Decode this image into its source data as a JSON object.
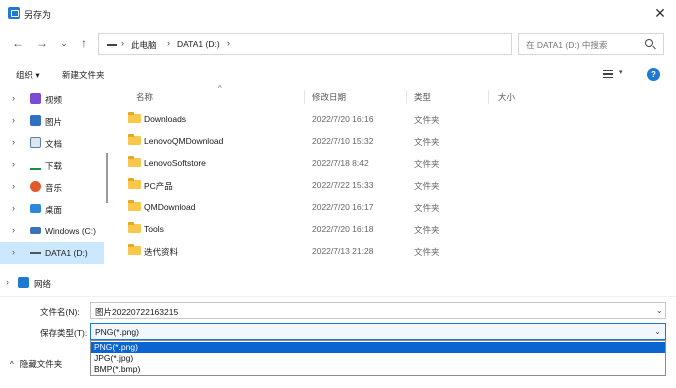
{
  "window": {
    "title": "另存为",
    "close_glyph": "✕"
  },
  "nav": {
    "back_glyph": "←",
    "forward_glyph": "→",
    "recent_glyph": "⌄",
    "up_glyph": "↑",
    "breadcrumb": [
      "此电脑",
      "DATA1 (D:)"
    ],
    "crumb_sep": "›",
    "dropdown_glyph": "⌄",
    "refresh_glyph": "↻"
  },
  "search": {
    "placeholder": "在 DATA1 (D:) 中搜索"
  },
  "toolbar": {
    "organize_label": "组织 ▾",
    "new_folder_label": "新建文件夹",
    "view_caret": "▾",
    "help_glyph": "?"
  },
  "sidebar": {
    "chevron": "›",
    "items": [
      {
        "label": "视频",
        "color": "#7b4bd6"
      },
      {
        "label": "图片",
        "color": "#2f6fc4"
      },
      {
        "label": "文档",
        "color": "#5c7fa6"
      },
      {
        "label": "下载",
        "color": "#1e8b4f"
      },
      {
        "label": "音乐",
        "color": "#e25a2b"
      },
      {
        "label": "桌面",
        "color": "#2a8ad9"
      },
      {
        "label": "Windows (C:)",
        "color": "#3c72b8"
      },
      {
        "label": "DATA1 (D:)",
        "color": "#555555"
      },
      {
        "label": "网络",
        "color": "#1f78d1"
      }
    ]
  },
  "columns": {
    "name": "名称",
    "date": "修改日期",
    "type": "类型",
    "size": "大小",
    "sort_glyph": "^"
  },
  "files": [
    {
      "name": "Downloads",
      "date": "2022/7/20 16:16",
      "type": "文件夹"
    },
    {
      "name": "LenovoQMDownload",
      "date": "2022/7/10 15:32",
      "type": "文件夹"
    },
    {
      "name": "LenovoSoftstore",
      "date": "2022/7/18 8:42",
      "type": "文件夹"
    },
    {
      "name": "PC产品",
      "date": "2022/7/22 15:33",
      "type": "文件夹"
    },
    {
      "name": "QMDownload",
      "date": "2022/7/20 16:17",
      "type": "文件夹"
    },
    {
      "name": "Tools",
      "date": "2022/7/20 16:18",
      "type": "文件夹"
    },
    {
      "name": "迭代资料",
      "date": "2022/7/13 21:28",
      "type": "文件夹"
    }
  ],
  "form": {
    "filename_label": "文件名(N):",
    "filename_value": "图片20220722163215",
    "filetype_label": "保存类型(T):",
    "filetype_value": "PNG(*.png)",
    "filetype_options": [
      "PNG(*.png)",
      "JPG(*.jpg)",
      "BMP(*.bmp)"
    ],
    "chevron_glyph": "⌄",
    "hide_folders_label": "隐藏文件夹",
    "hide_caret": "^"
  },
  "colors": {
    "accent": "#1f78d1",
    "selection": "#0a64d2",
    "nav_selected_bg": "#cce8ff",
    "folder": "#f8c74b"
  }
}
